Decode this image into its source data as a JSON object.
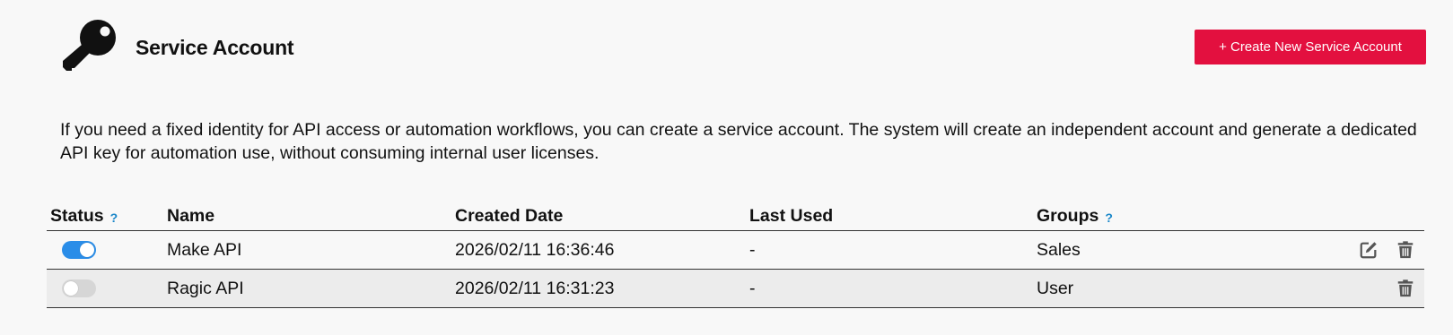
{
  "header": {
    "icon": "key-icon",
    "title": "Service Account",
    "create_button_label": "+ Create New Service Account",
    "accent_color": "#e3103f"
  },
  "description": "If you need a fixed identity for API access or automation workflows, you can create a service account. The system will create an independent account and generate a dedicated API key for automation use, without consuming internal user licenses.",
  "table": {
    "columns": {
      "status": "Status",
      "name": "Name",
      "created": "Created Date",
      "last_used": "Last Used",
      "groups": "Groups"
    },
    "help_marker": "?",
    "rows": [
      {
        "status_enabled": true,
        "name": "Make API",
        "created": "2026/02/11 16:36:46",
        "last_used": "-",
        "groups": "Sales",
        "actions": [
          "edit-icon",
          "trash-icon"
        ]
      },
      {
        "status_enabled": false,
        "name": "Ragic API",
        "created": "2026/02/11 16:31:23",
        "last_used": "-",
        "groups": "User",
        "actions": [
          "trash-icon"
        ]
      }
    ]
  },
  "colors": {
    "toggle_on": "#2a8de8",
    "toggle_off": "#d6d6d6",
    "help_marker": "#1a87c9"
  }
}
